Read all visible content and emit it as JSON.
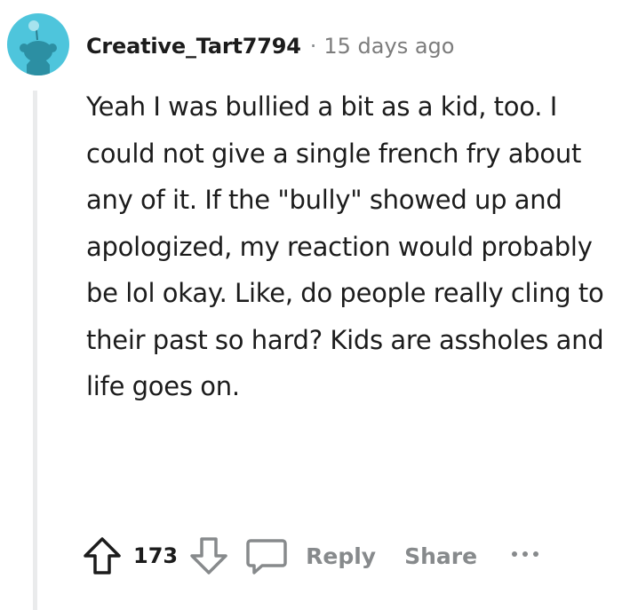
{
  "comment": {
    "username": "Creative_Tart7794",
    "separator": "·",
    "time_ago": "15 days ago",
    "body": "Yeah I was bullied a bit as a kid, too. I could not give a single french fry about any of it. If the \"bully\" showed up and apologized, my reaction would probably be lol okay. Like, do people really cling to their past so hard? Kids are assholes and life goes on."
  },
  "actions": {
    "upvote_icon": "arrow-up-icon",
    "vote_count": "173",
    "downvote_icon": "arrow-down-icon",
    "comment_icon": "speech-bubble-icon",
    "reply_label": "Reply",
    "share_label": "Share",
    "more_icon": "ellipsis-icon"
  },
  "colors": {
    "avatar_background": "#4ec5dc",
    "meta_gray": "#878a8c",
    "thread_line": "#eaebec",
    "text": "#1c1c1c"
  }
}
